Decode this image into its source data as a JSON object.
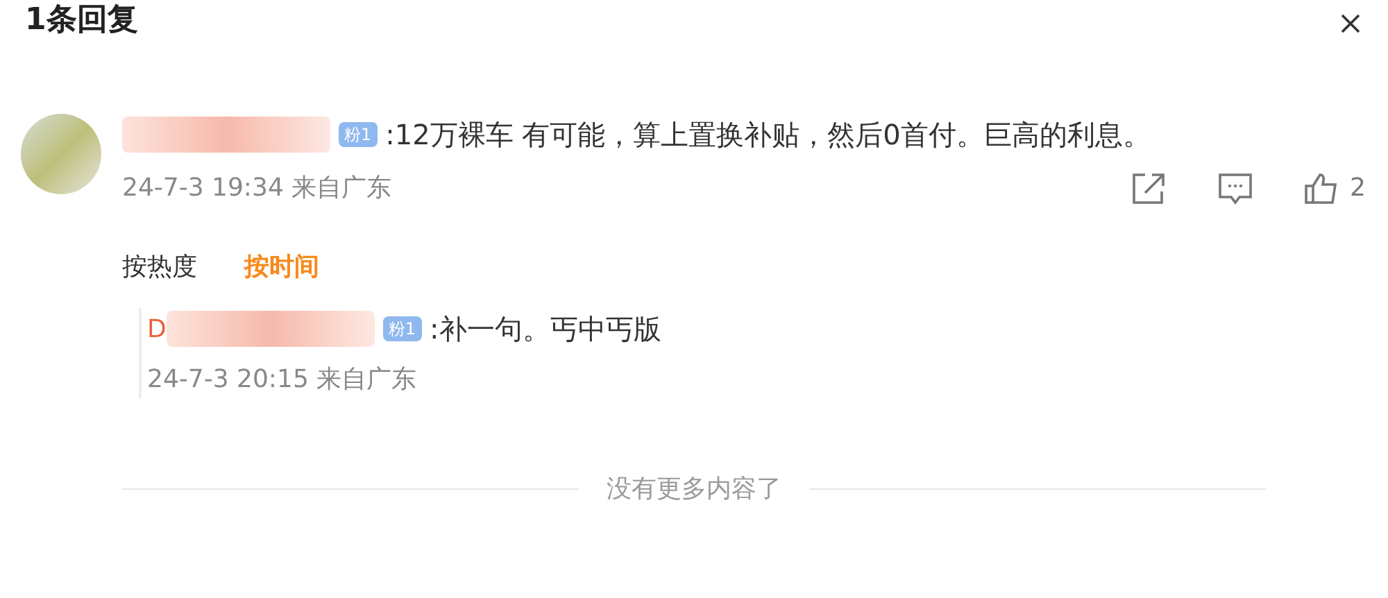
{
  "title": "1条回复",
  "comment": {
    "badge": "粉1",
    "text": ":12万裸车 有可能，算上置换补贴，然后0首付。巨高的利息。",
    "time": "24-7-3 19:34 来自广东",
    "like_count": "2"
  },
  "sort_tabs": [
    {
      "label": "按热度",
      "selected": false
    },
    {
      "label": "按时间",
      "selected": true
    }
  ],
  "replies": [
    {
      "name_initial": "D",
      "badge": "粉1",
      "text": ":补一句。丐中丐版",
      "time": "24-7-3 20:15 来自广东"
    }
  ],
  "footer": "没有更多内容了"
}
